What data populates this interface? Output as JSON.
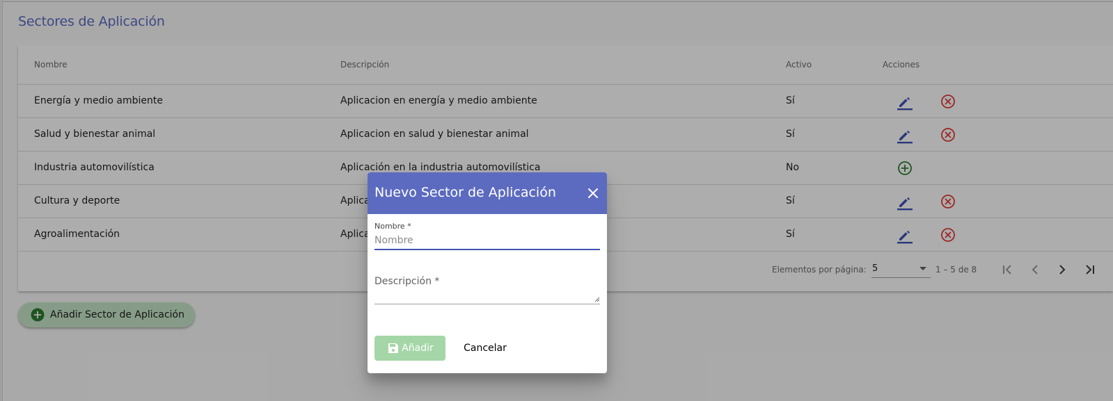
{
  "page": {
    "title": "Sectores de Aplicación"
  },
  "table": {
    "headers": {
      "name": "Nombre",
      "description": "Descripción",
      "active": "Activo",
      "actions": "Acciones"
    },
    "rows": [
      {
        "name": "Energía y medio ambiente",
        "description": "Aplicacion en energía y medio ambiente",
        "active": "Sí"
      },
      {
        "name": "Salud y bienestar animal",
        "description": "Aplicacion en salud y bienestar animal",
        "active": "Sí"
      },
      {
        "name": "Industria automovilística",
        "description": "Aplicación en la industria automovilística",
        "active": "No"
      },
      {
        "name": "Cultura y deporte",
        "description": "Aplica",
        "active": "Sí"
      },
      {
        "name": "Agroalimentación",
        "description": "Aplica",
        "active": "Sí"
      }
    ]
  },
  "paginator": {
    "items_per_page_label": "Elementos por página:",
    "page_size": "5",
    "range": "1 – 5 de 8"
  },
  "add_button": {
    "label": "Añadir Sector de Aplicación"
  },
  "dialog": {
    "title": "Nuevo Sector de Aplicación",
    "name_label": "Nombre *",
    "name_placeholder": "Nombre",
    "description_label": "Descripción *",
    "save_label": "Añadir",
    "cancel_label": "Cancelar"
  },
  "colors": {
    "primary": "#5c6bc0",
    "edit": "#3f51b5",
    "delete": "#e53935",
    "activate": "#2e7d32",
    "add_button_bg": "#c8e6c9",
    "save_button_bg": "#a5d6a7"
  }
}
